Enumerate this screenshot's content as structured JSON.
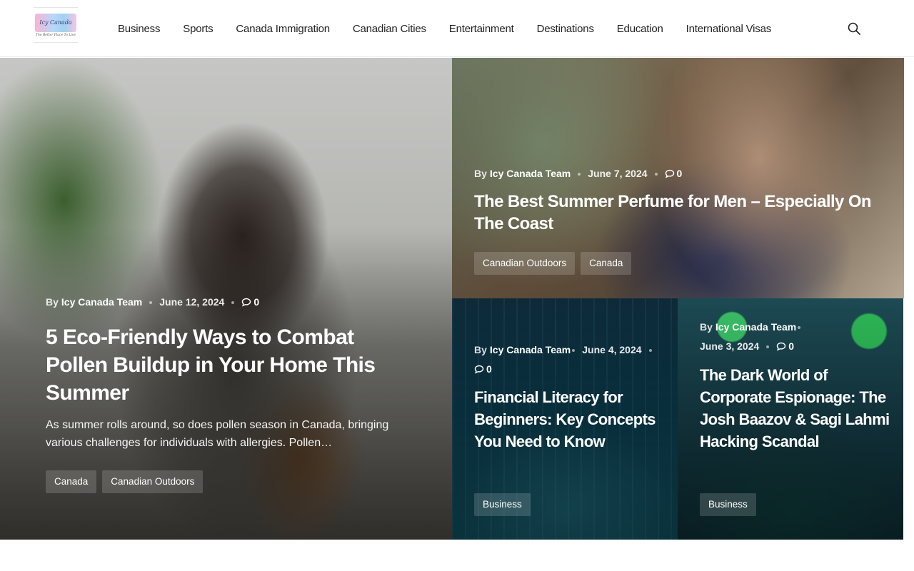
{
  "header": {
    "logo": {
      "name": "Icy Canada",
      "tagline": "The Better Place To Live"
    },
    "nav": [
      "Business",
      "Sports",
      "Canada Immigration",
      "Canadian Cities",
      "Entertainment",
      "Destinations",
      "Education",
      "International Visas"
    ],
    "search_icon": "search-icon"
  },
  "posts": [
    {
      "by": "By",
      "author": "Icy Canada Team",
      "date": "June 12, 2024",
      "comments": "0",
      "title": "5 Eco-Friendly Ways to Combat Pollen Buildup in Your Home This Summer",
      "excerpt": "As summer rolls around, so does pollen season in Canada, bringing various challenges for individuals with allergies. Pollen…",
      "tags": [
        "Canada",
        "Canadian Outdoors"
      ]
    },
    {
      "by": "By",
      "author": "Icy Canada Team",
      "date": "June 7, 2024",
      "comments": "0",
      "title": "The Best Summer Perfume for Men – Especially On The Coast",
      "tags": [
        "Canadian Outdoors",
        "Canada"
      ]
    },
    {
      "by": "By",
      "author": "Icy Canada Team",
      "date": "June 4, 2024",
      "comments": "0",
      "title": "Financial Literacy for Beginners: Key Concepts You Need to Know",
      "tags": [
        "Business"
      ]
    },
    {
      "by": "By",
      "author": "Icy Canada Team",
      "date": "June 3, 2024",
      "comments": "0",
      "title": "The Dark World of Corporate Espionage: The Josh Baazov & Sagi Lahmi Hacking Scandal",
      "tags": [
        "Business"
      ]
    }
  ]
}
